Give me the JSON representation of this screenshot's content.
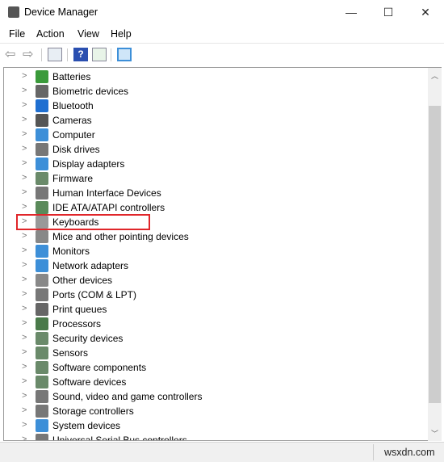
{
  "window": {
    "title": "Device Manager",
    "minimize": "—",
    "maximize": "☐",
    "close": "✕"
  },
  "menu": [
    "File",
    "Action",
    "View",
    "Help"
  ],
  "toolbar": [
    "back-icon",
    "forward-icon",
    "show-hide-console-tree-icon",
    "help-icon",
    "properties-pane-icon",
    "scan-hardware-icon"
  ],
  "tree": {
    "items": [
      {
        "label": "Batteries",
        "color": "#3a9a3a"
      },
      {
        "label": "Biometric devices",
        "color": "#666"
      },
      {
        "label": "Bluetooth",
        "color": "#1f6fd1"
      },
      {
        "label": "Cameras",
        "color": "#555"
      },
      {
        "label": "Computer",
        "color": "#3d8fd8"
      },
      {
        "label": "Disk drives",
        "color": "#777"
      },
      {
        "label": "Display adapters",
        "color": "#3d8fd8"
      },
      {
        "label": "Firmware",
        "color": "#6a8a6a"
      },
      {
        "label": "Human Interface Devices",
        "color": "#777"
      },
      {
        "label": "IDE ATA/ATAPI controllers",
        "color": "#5a8a5a"
      },
      {
        "label": "Keyboards",
        "color": "#999"
      },
      {
        "label": "Mice and other pointing devices",
        "color": "#888"
      },
      {
        "label": "Monitors",
        "color": "#3d8fd8"
      },
      {
        "label": "Network adapters",
        "color": "#3d8fd8"
      },
      {
        "label": "Other devices",
        "color": "#888"
      },
      {
        "label": "Ports (COM & LPT)",
        "color": "#777"
      },
      {
        "label": "Print queues",
        "color": "#666"
      },
      {
        "label": "Processors",
        "color": "#4a7a4a"
      },
      {
        "label": "Security devices",
        "color": "#6a8a6a"
      },
      {
        "label": "Sensors",
        "color": "#6a8a6a"
      },
      {
        "label": "Software components",
        "color": "#6a8a6a"
      },
      {
        "label": "Software devices",
        "color": "#6a8a6a"
      },
      {
        "label": "Sound, video and game controllers",
        "color": "#777"
      },
      {
        "label": "Storage controllers",
        "color": "#777"
      },
      {
        "label": "System devices",
        "color": "#3d8fd8"
      },
      {
        "label": "Universal Serial Bus controllers",
        "color": "#777"
      }
    ],
    "highlighted": "Keyboards",
    "highlight_color": "#e0262a"
  },
  "status": {
    "watermark": "wsxdn.com"
  }
}
